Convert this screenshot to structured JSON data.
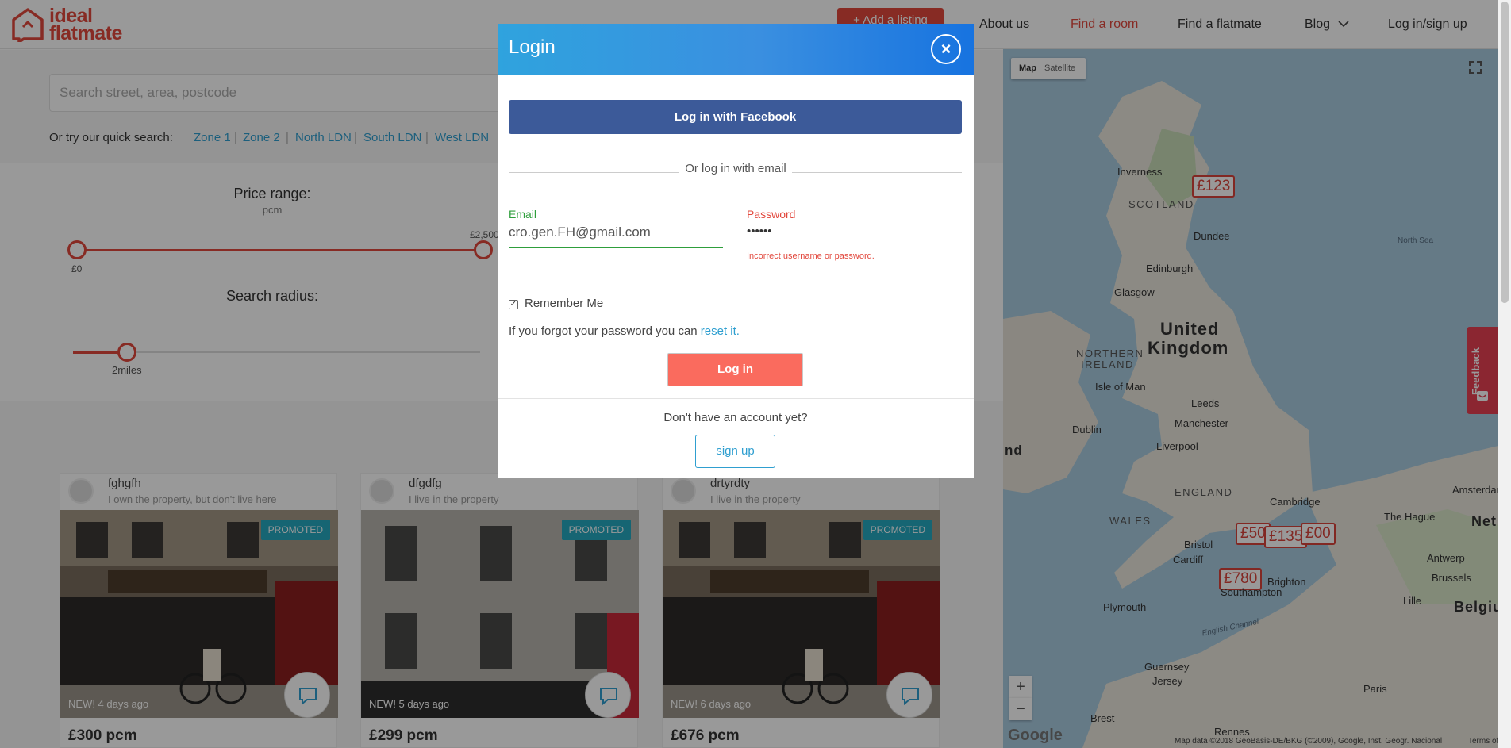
{
  "brand": {
    "line1": "ideal",
    "line2": "flatmate",
    "color": "#e2483d"
  },
  "header": {
    "add_listing": "+ Add a listing",
    "nav": [
      {
        "label": "About us"
      },
      {
        "label": "Find a room"
      },
      {
        "label": "Find a flatmate"
      },
      {
        "label": "Blog"
      },
      {
        "label": "Log in/sign up"
      }
    ]
  },
  "search": {
    "placeholder": "Search street, area, postcode"
  },
  "quick_search": {
    "label": "Or try our quick search:",
    "links": [
      "Zone 1",
      "Zone 2",
      "North LDN",
      "South LDN",
      "West LDN"
    ]
  },
  "filters": {
    "price_title": "Price range:",
    "price_unit": "pcm",
    "price_min_label": "£0",
    "price_max_label": "£2,500",
    "radius_title": "Search radius:",
    "radius_label": "2miles"
  },
  "listings": [
    {
      "name": "fghgfh",
      "role": "I own the property, but don't live here",
      "badge": "PROMOTED",
      "age": "NEW! 4 days ago",
      "price": "£300 pcm"
    },
    {
      "name": "dfgdfg",
      "role": "I live in the property",
      "badge": "PROMOTED",
      "age": "NEW! 5 days ago",
      "price": "£299 pcm"
    },
    {
      "name": "drtyrdty",
      "role": "I live in the property",
      "badge": "PROMOTED",
      "age": "NEW! 6 days ago",
      "price": "£676 pcm"
    }
  ],
  "map": {
    "toggle": [
      "Map",
      "Satellite"
    ],
    "pins": [
      "£123",
      "£50",
      "£135",
      "£00",
      "£780"
    ],
    "countries": [
      "United",
      "Kingdom"
    ],
    "regions": [
      "SCOTLAND",
      "NORTHERN",
      "IRELAND",
      "ENGLAND",
      "WALES"
    ],
    "cities": [
      "Inverness",
      "Dundee",
      "Edinburgh",
      "Glasgow",
      "Isle of Man",
      "Leeds",
      "Manchester",
      "Liverpool",
      "Dublin",
      "Cambridge",
      "Bristol",
      "Cardiff",
      "Brighton",
      "Southampton",
      "Plymouth",
      "Guernsey",
      "Jersey",
      "Brest",
      "Rennes",
      "Paris",
      "Lille",
      "Brussels",
      "Antwerp",
      "The Hague",
      "Amsterdam",
      "Belgium",
      "Neth",
      "nd"
    ],
    "seas": [
      "North Sea",
      "English Channel"
    ],
    "zoom_in": "+",
    "zoom_out": "−",
    "attribution": "Map data ©2018 GeoBasis-DE/BKG (©2009), Google, Inst. Geogr. Nacional",
    "terms": "Terms of U",
    "google": "Google"
  },
  "feedback": "Feedback",
  "modal": {
    "title": "Login",
    "close": "×",
    "facebook": "Log in with Facebook",
    "or_email": "Or log in with email",
    "email_label": "Email",
    "email_value": "cro.gen.FH@gmail.com",
    "password_label": "Password",
    "password_value": "••••••",
    "password_error": "Incorrect username or password.",
    "remember": "Remember Me",
    "forgot_prefix": "If you forgot your password you can ",
    "forgot_link": "reset it.",
    "login_button": "Log in",
    "no_account": "Don't have an account yet?",
    "signup": "sign up"
  }
}
